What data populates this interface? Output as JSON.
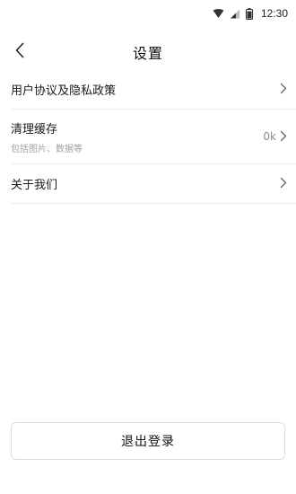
{
  "status_bar": {
    "time": "12:30",
    "icons": [
      "wifi-icon",
      "signal-icon",
      "battery-icon"
    ]
  },
  "header": {
    "back_icon": "chevron-left-icon",
    "title": "设置"
  },
  "settings": {
    "items": [
      {
        "label": "用户协议及隐私政策",
        "chevron_icon": "chevron-right-icon"
      },
      {
        "label": "清理缓存",
        "sublabel": "包括图片、数据等",
        "value": "0k",
        "chevron_icon": "chevron-right-icon"
      },
      {
        "label": "关于我们",
        "chevron_icon": "chevron-right-icon"
      }
    ]
  },
  "logout": {
    "label": "退出登录"
  },
  "colors": {
    "background": "#ffffff",
    "divider": "#ececec",
    "text_primary": "#1a1a1a",
    "text_secondary": "#a0a0a0",
    "value_text": "#8a8a8a",
    "button_border": "#dcdcdc"
  }
}
